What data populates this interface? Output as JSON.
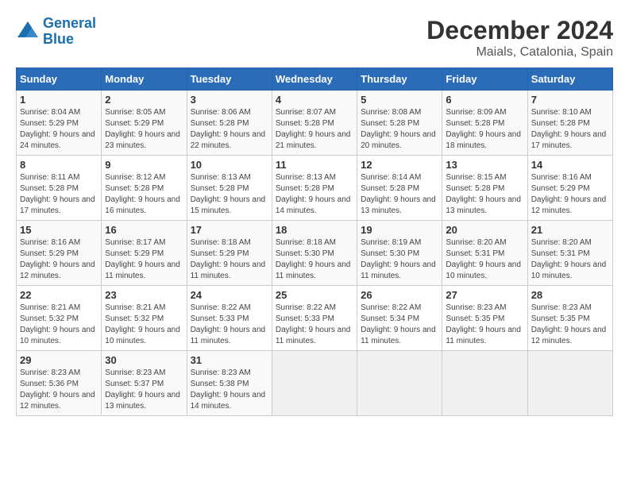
{
  "logo": {
    "line1": "General",
    "line2": "Blue"
  },
  "title": "December 2024",
  "subtitle": "Maials, Catalonia, Spain",
  "days_of_week": [
    "Sunday",
    "Monday",
    "Tuesday",
    "Wednesday",
    "Thursday",
    "Friday",
    "Saturday"
  ],
  "weeks": [
    [
      {
        "day": "1",
        "sunrise": "Sunrise: 8:04 AM",
        "sunset": "Sunset: 5:29 PM",
        "daylight": "Daylight: 9 hours and 24 minutes."
      },
      {
        "day": "2",
        "sunrise": "Sunrise: 8:05 AM",
        "sunset": "Sunset: 5:29 PM",
        "daylight": "Daylight: 9 hours and 23 minutes."
      },
      {
        "day": "3",
        "sunrise": "Sunrise: 8:06 AM",
        "sunset": "Sunset: 5:28 PM",
        "daylight": "Daylight: 9 hours and 22 minutes."
      },
      {
        "day": "4",
        "sunrise": "Sunrise: 8:07 AM",
        "sunset": "Sunset: 5:28 PM",
        "daylight": "Daylight: 9 hours and 21 minutes."
      },
      {
        "day": "5",
        "sunrise": "Sunrise: 8:08 AM",
        "sunset": "Sunset: 5:28 PM",
        "daylight": "Daylight: 9 hours and 20 minutes."
      },
      {
        "day": "6",
        "sunrise": "Sunrise: 8:09 AM",
        "sunset": "Sunset: 5:28 PM",
        "daylight": "Daylight: 9 hours and 18 minutes."
      },
      {
        "day": "7",
        "sunrise": "Sunrise: 8:10 AM",
        "sunset": "Sunset: 5:28 PM",
        "daylight": "Daylight: 9 hours and 17 minutes."
      }
    ],
    [
      {
        "day": "8",
        "sunrise": "Sunrise: 8:11 AM",
        "sunset": "Sunset: 5:28 PM",
        "daylight": "Daylight: 9 hours and 17 minutes."
      },
      {
        "day": "9",
        "sunrise": "Sunrise: 8:12 AM",
        "sunset": "Sunset: 5:28 PM",
        "daylight": "Daylight: 9 hours and 16 minutes."
      },
      {
        "day": "10",
        "sunrise": "Sunrise: 8:13 AM",
        "sunset": "Sunset: 5:28 PM",
        "daylight": "Daylight: 9 hours and 15 minutes."
      },
      {
        "day": "11",
        "sunrise": "Sunrise: 8:13 AM",
        "sunset": "Sunset: 5:28 PM",
        "daylight": "Daylight: 9 hours and 14 minutes."
      },
      {
        "day": "12",
        "sunrise": "Sunrise: 8:14 AM",
        "sunset": "Sunset: 5:28 PM",
        "daylight": "Daylight: 9 hours and 13 minutes."
      },
      {
        "day": "13",
        "sunrise": "Sunrise: 8:15 AM",
        "sunset": "Sunset: 5:28 PM",
        "daylight": "Daylight: 9 hours and 13 minutes."
      },
      {
        "day": "14",
        "sunrise": "Sunrise: 8:16 AM",
        "sunset": "Sunset: 5:29 PM",
        "daylight": "Daylight: 9 hours and 12 minutes."
      }
    ],
    [
      {
        "day": "15",
        "sunrise": "Sunrise: 8:16 AM",
        "sunset": "Sunset: 5:29 PM",
        "daylight": "Daylight: 9 hours and 12 minutes."
      },
      {
        "day": "16",
        "sunrise": "Sunrise: 8:17 AM",
        "sunset": "Sunset: 5:29 PM",
        "daylight": "Daylight: 9 hours and 11 minutes."
      },
      {
        "day": "17",
        "sunrise": "Sunrise: 8:18 AM",
        "sunset": "Sunset: 5:29 PM",
        "daylight": "Daylight: 9 hours and 11 minutes."
      },
      {
        "day": "18",
        "sunrise": "Sunrise: 8:18 AM",
        "sunset": "Sunset: 5:30 PM",
        "daylight": "Daylight: 9 hours and 11 minutes."
      },
      {
        "day": "19",
        "sunrise": "Sunrise: 8:19 AM",
        "sunset": "Sunset: 5:30 PM",
        "daylight": "Daylight: 9 hours and 11 minutes."
      },
      {
        "day": "20",
        "sunrise": "Sunrise: 8:20 AM",
        "sunset": "Sunset: 5:31 PM",
        "daylight": "Daylight: 9 hours and 10 minutes."
      },
      {
        "day": "21",
        "sunrise": "Sunrise: 8:20 AM",
        "sunset": "Sunset: 5:31 PM",
        "daylight": "Daylight: 9 hours and 10 minutes."
      }
    ],
    [
      {
        "day": "22",
        "sunrise": "Sunrise: 8:21 AM",
        "sunset": "Sunset: 5:32 PM",
        "daylight": "Daylight: 9 hours and 10 minutes."
      },
      {
        "day": "23",
        "sunrise": "Sunrise: 8:21 AM",
        "sunset": "Sunset: 5:32 PM",
        "daylight": "Daylight: 9 hours and 10 minutes."
      },
      {
        "day": "24",
        "sunrise": "Sunrise: 8:22 AM",
        "sunset": "Sunset: 5:33 PM",
        "daylight": "Daylight: 9 hours and 11 minutes."
      },
      {
        "day": "25",
        "sunrise": "Sunrise: 8:22 AM",
        "sunset": "Sunset: 5:33 PM",
        "daylight": "Daylight: 9 hours and 11 minutes."
      },
      {
        "day": "26",
        "sunrise": "Sunrise: 8:22 AM",
        "sunset": "Sunset: 5:34 PM",
        "daylight": "Daylight: 9 hours and 11 minutes."
      },
      {
        "day": "27",
        "sunrise": "Sunrise: 8:23 AM",
        "sunset": "Sunset: 5:35 PM",
        "daylight": "Daylight: 9 hours and 11 minutes."
      },
      {
        "day": "28",
        "sunrise": "Sunrise: 8:23 AM",
        "sunset": "Sunset: 5:35 PM",
        "daylight": "Daylight: 9 hours and 12 minutes."
      }
    ],
    [
      {
        "day": "29",
        "sunrise": "Sunrise: 8:23 AM",
        "sunset": "Sunset: 5:36 PM",
        "daylight": "Daylight: 9 hours and 12 minutes."
      },
      {
        "day": "30",
        "sunrise": "Sunrise: 8:23 AM",
        "sunset": "Sunset: 5:37 PM",
        "daylight": "Daylight: 9 hours and 13 minutes."
      },
      {
        "day": "31",
        "sunrise": "Sunrise: 8:23 AM",
        "sunset": "Sunset: 5:38 PM",
        "daylight": "Daylight: 9 hours and 14 minutes."
      },
      null,
      null,
      null,
      null
    ]
  ]
}
